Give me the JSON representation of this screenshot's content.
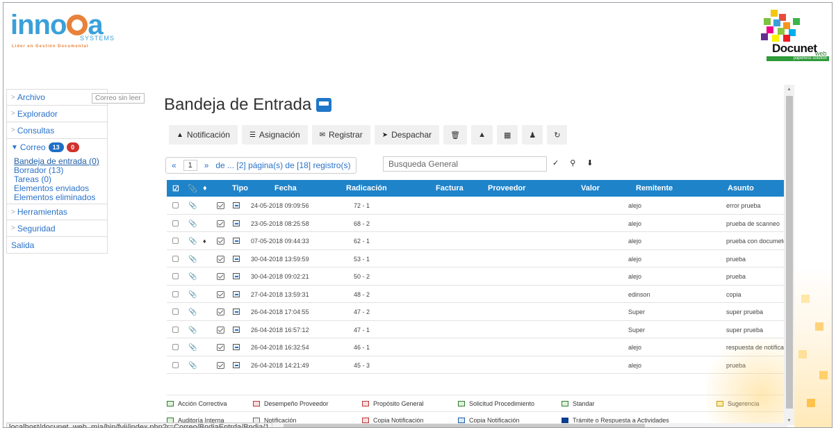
{
  "header": {
    "innova_logo": {
      "word": "inno",
      "sub": "SYSTEMS",
      "tagline": "Lider en Gestión Documental"
    },
    "docunet_logo": {
      "word": "Docunet",
      "web": "web",
      "bar": "paperless solution"
    }
  },
  "sidebar": {
    "items": [
      {
        "label": "Archivo"
      },
      {
        "label": "Explorador"
      },
      {
        "label": "Consultas"
      },
      {
        "label": "Correo",
        "badge_blue": "13",
        "badge_red": "0"
      },
      {
        "label": "Herramientas"
      },
      {
        "label": "Seguridad"
      },
      {
        "label": "Salida"
      }
    ],
    "correo_sub": [
      {
        "label": "Bandeja de entrada (0)"
      },
      {
        "label": "Borrador (13)"
      },
      {
        "label": "Tareas (0)"
      },
      {
        "label": "Elementos enviados"
      },
      {
        "label": "Elementos eliminados"
      }
    ],
    "tooltip": "Correo sin leer"
  },
  "main": {
    "title": "Bandeja de Entrada",
    "toolbar": {
      "notificacion": "Notificación",
      "asignacion": "Asignación",
      "registrar": "Registrar",
      "despachar": "Despachar"
    },
    "pager": {
      "prev": "«",
      "page": "1",
      "next": "»",
      "info": "de ... [2] página(s) de [18] registro(s)"
    },
    "search": {
      "placeholder": "Busqueda General"
    },
    "columns": {
      "tipo": "Tipo",
      "fecha": "Fecha",
      "radicacion": "Radicación",
      "factura": "Factura",
      "proveedor": "Proveedor",
      "valor": "Valor",
      "remitente": "Remitente",
      "asunto": "Asunto"
    },
    "rows": [
      {
        "fecha": "24-05-2018 09:09:56",
        "radicacion": "72 - 1",
        "remitente": "alejo",
        "asunto": "error prueba",
        "tag": false
      },
      {
        "fecha": "23-05-2018 08:25:58",
        "radicacion": "68 - 2",
        "remitente": "alejo",
        "asunto": "prueba de scanneo",
        "tag": false
      },
      {
        "fecha": "07-05-2018 09:44:33",
        "radicacion": "62 - 1",
        "remitente": "alejo",
        "asunto": "prueba con documeto c",
        "tag": true
      },
      {
        "fecha": "30-04-2018 13:59:59",
        "radicacion": "53 - 1",
        "remitente": "alejo",
        "asunto": "prueba",
        "tag": false
      },
      {
        "fecha": "30-04-2018 09:02:21",
        "radicacion": "50 - 2",
        "remitente": "alejo",
        "asunto": "prueba",
        "tag": false
      },
      {
        "fecha": "27-04-2018 13:59:31",
        "radicacion": "48 - 2",
        "remitente": "edinson",
        "asunto": "copia",
        "tag": false
      },
      {
        "fecha": "26-04-2018 17:04:55",
        "radicacion": "47 - 2",
        "remitente": "Super",
        "asunto": "super prueba",
        "tag": false
      },
      {
        "fecha": "26-04-2018 16:57:12",
        "radicacion": "47 - 1",
        "remitente": "Super",
        "asunto": "super prueba",
        "tag": false
      },
      {
        "fecha": "26-04-2018 16:32:54",
        "radicacion": "46 - 1",
        "remitente": "alejo",
        "asunto": "respuesta de notificacic",
        "tag": false
      },
      {
        "fecha": "26-04-2018 14:21:49",
        "radicacion": "45 - 3",
        "remitente": "alejo",
        "asunto": "prueba",
        "tag": false
      }
    ],
    "legend": {
      "row1": [
        "Acción Correctiva",
        "Desempeño Proveedor",
        "Propósito General",
        "Solicitud Procedimiento",
        "Standar",
        "Sugerencia"
      ],
      "row2": [
        "Auditoría Interna",
        "Notificación",
        "Copia Notificación",
        "Copia Notificación",
        "Trámite o Respuesta a Actividades"
      ]
    }
  },
  "status_bar": {
    "url": "localhost/docunet_web_mia/bin/fvii/index.php?r=Correo/BndiaEntrda/Bndia/1"
  },
  "colors": {
    "accent": "#1f83c9",
    "link": "#2a72c9",
    "badge_blue": "#1e6fc4",
    "badge_red": "#d0312d"
  }
}
